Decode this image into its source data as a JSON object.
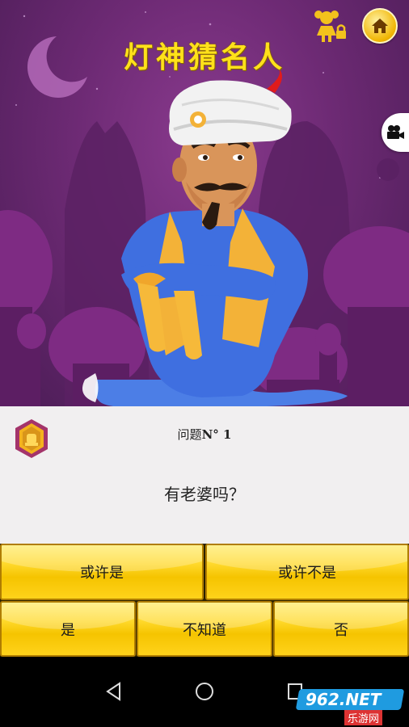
{
  "header": {
    "title": "灯神猜名人",
    "icons": [
      "girl-lock-icon",
      "home-icon",
      "video-camera-icon"
    ]
  },
  "question": {
    "number_prefix": "问题",
    "number_suffix": "N° 1",
    "text": "有老婆吗？"
  },
  "answers": {
    "probably": "或许是",
    "probably_not": "或许不是",
    "yes": "是",
    "dont_know": "不知道",
    "no": "否"
  },
  "watermark": {
    "brand": "962.NET",
    "site": "乐游网"
  },
  "colors": {
    "title": "#ffe11a",
    "button": "#ffd92b",
    "background": "#6d2a74",
    "panel": "#f1eff0"
  }
}
